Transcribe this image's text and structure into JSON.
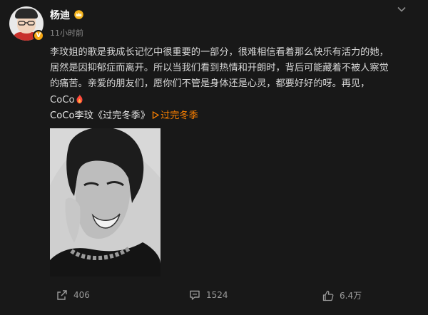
{
  "post": {
    "author": "杨迪",
    "time": "11小时前",
    "lines": [
      "李玟姐的歌是我成长记忆中很重要的一部分，很难相信看着那么快乐有活力的她，",
      "居然是因抑郁症而离开。所以当我们看到热情和开朗时，背后可能藏着不被人察觉",
      "的痛苦。亲爱的朋友们，愿你们不管是身体还是心灵，都要好好的呀。再见，",
      "CoCo"
    ],
    "topic_text": "CoCo李玟《过完冬季》",
    "link_text": "过完冬季"
  },
  "actions": {
    "share_count": "406",
    "comment_count": "1524",
    "like_count": "6.4万"
  },
  "icons": {
    "verified": "verified-badge-icon",
    "crown": "crown-icon",
    "more": "chevron-down-icon",
    "emoji": "candle-emoji-icon",
    "play": "play-icon",
    "share": "share-icon",
    "comment": "comment-icon",
    "like": "thumbs-up-icon"
  },
  "colors": {
    "background": "#181818",
    "link": "#ff8200",
    "text": "#d9d9d9",
    "muted": "#8a8a8a"
  }
}
